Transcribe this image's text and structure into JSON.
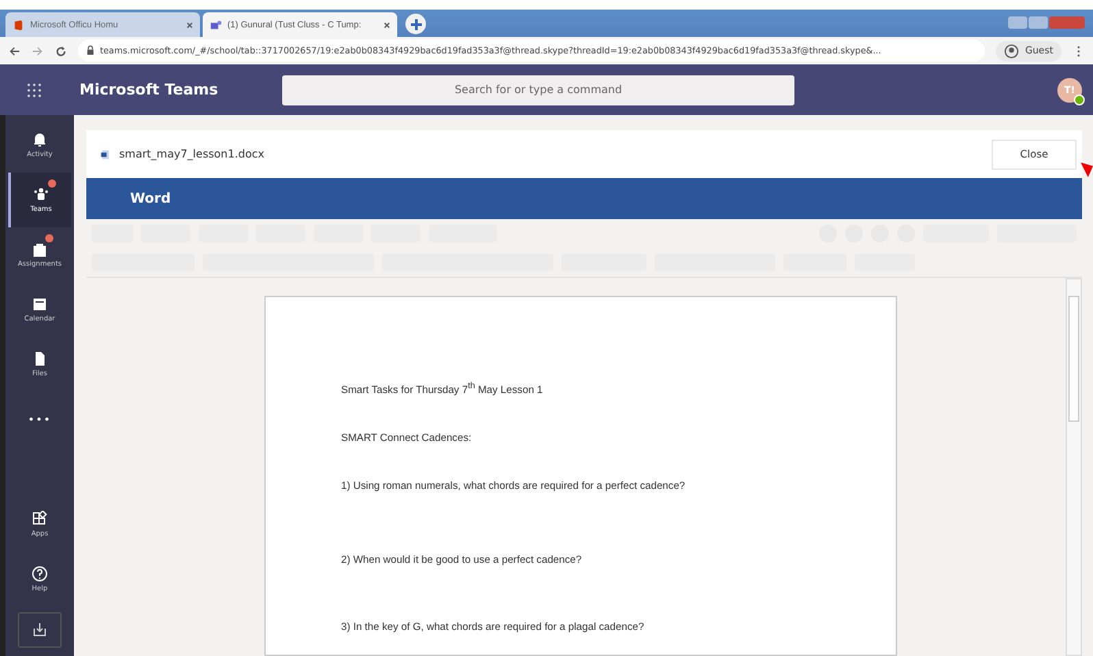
{
  "browser": {
    "tabs": [
      {
        "title": "Microsoft Officu Homu",
        "selected": false
      },
      {
        "title": "(1) Gunural (Tust Cluss - C Tump:",
        "selected": true
      }
    ],
    "url": "teams.microsoft.com/_#/school/tab::3717002657/19:e2ab0b08343f4929bac6d19fad353a3f@thread.skype?threadId=19:e2ab0b08343f4929bac6d19fad353a3f@thread.skype&...",
    "profile": "Guest"
  },
  "app": {
    "title": "Microsoft Teams",
    "search": {
      "placeholder": "Search for or type a command"
    },
    "avatar": "T!"
  },
  "rail": [
    {
      "label": "Activity",
      "kind": "bell",
      "selected": false,
      "badge": false
    },
    {
      "label": "Teams",
      "kind": "teams",
      "selected": true,
      "badge": true
    },
    {
      "label": "Assignments",
      "kind": "bag",
      "selected": false,
      "badge": true
    },
    {
      "label": "Calendar",
      "kind": "calendar",
      "selected": false,
      "badge": false
    },
    {
      "label": "Files",
      "kind": "file",
      "selected": false,
      "badge": false
    },
    {
      "label": "•••",
      "kind": "more",
      "selected": false,
      "badge": false
    }
  ],
  "rail_bottom": [
    {
      "label": "Apps",
      "kind": "apps"
    },
    {
      "label": "Help",
      "kind": "help"
    }
  ],
  "file": {
    "name": "smart_may7_lesson1.docx",
    "close": "Close"
  },
  "word": {
    "title": "Word"
  },
  "document": {
    "lines": [
      "Smart Tasks for Thursday 7$^{th}$ May Lesson 1",
      "SMART Connect Cadences:",
      "1)  Using roman numerals, what chords are required for a perfect cadence?",
      "2)  When would it be good to use a perfect cadence?",
      "3)  In the key of G, what chords are required for a plagal cadence?"
    ]
  }
}
